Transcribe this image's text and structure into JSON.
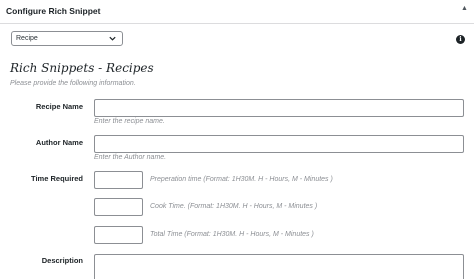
{
  "panel": {
    "title": "Configure Rich Snippet",
    "collapse_glyph": "▲"
  },
  "schema_select": {
    "selected": "Recipe"
  },
  "info_glyph": "i",
  "form": {
    "heading": "Rich Snippets - Recipes",
    "subheading": "Please provide the following information.",
    "recipe_name": {
      "label": "Recipe Name",
      "hint": "Enter the recipe name."
    },
    "author_name": {
      "label": "Author Name",
      "hint": "Enter the Author name."
    },
    "time_required": {
      "label": "Time Required",
      "prep_hint": "Preperation time (Format: 1H30M. H - Hours, M - Minutes )",
      "cook_hint": "Cook Time. (Format: 1H30M. H - Hours, M - Minutes )",
      "total_hint": "Total Time (Format: 1H30M. H - Hours, M - Minutes )"
    },
    "description": {
      "label": "Description"
    }
  }
}
